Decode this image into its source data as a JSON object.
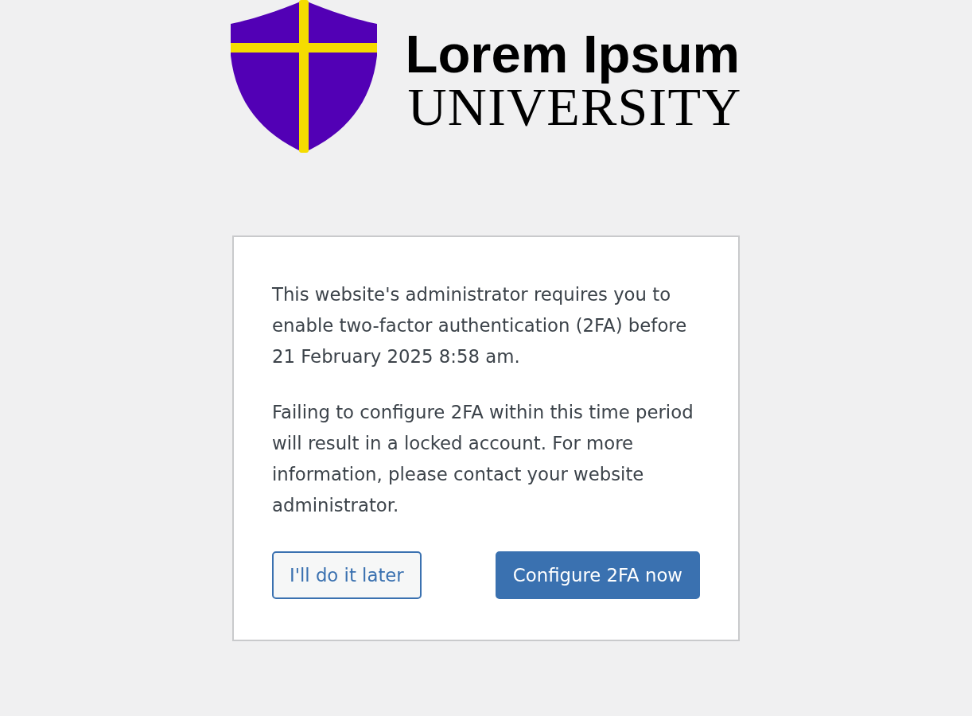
{
  "logo": {
    "name": "Lorem Ipsum",
    "subtitle": "UNIVERSITY"
  },
  "notice": {
    "paragraphs": [
      "This website's administrator requires you to enable two-factor authentication (2FA) before 21 February 2025 8:58 am.",
      "Failing to configure 2FA within this time period will result in a locked account. For more information, please contact your website administrator."
    ]
  },
  "buttons": [
    {
      "label": "I'll do it later",
      "kind": "secondary"
    },
    {
      "label": "Configure 2FA now",
      "kind": "primary"
    }
  ]
}
